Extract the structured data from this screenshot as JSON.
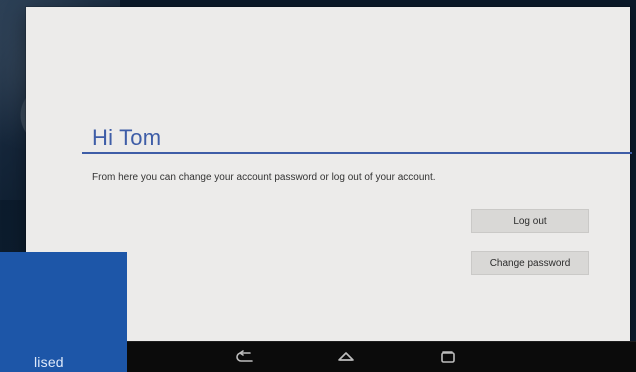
{
  "screen": {
    "greeting": "Hi Tom",
    "info_text": "From here you can change your account password or log out of your account."
  },
  "buttons": {
    "logout_label": "Log out",
    "change_password_label": "Change password"
  },
  "nav_bar": {
    "icons": [
      "back-icon",
      "home-icon",
      "recents-icon"
    ]
  },
  "overlay": {
    "partial_text": "lised"
  },
  "colors": {
    "accent": "#3e5da7",
    "screen_bg": "#ecebea",
    "button_bg": "#d9d8d6",
    "blue_panel": "#1d56a8",
    "nav_bar": "#0b0b0b"
  }
}
